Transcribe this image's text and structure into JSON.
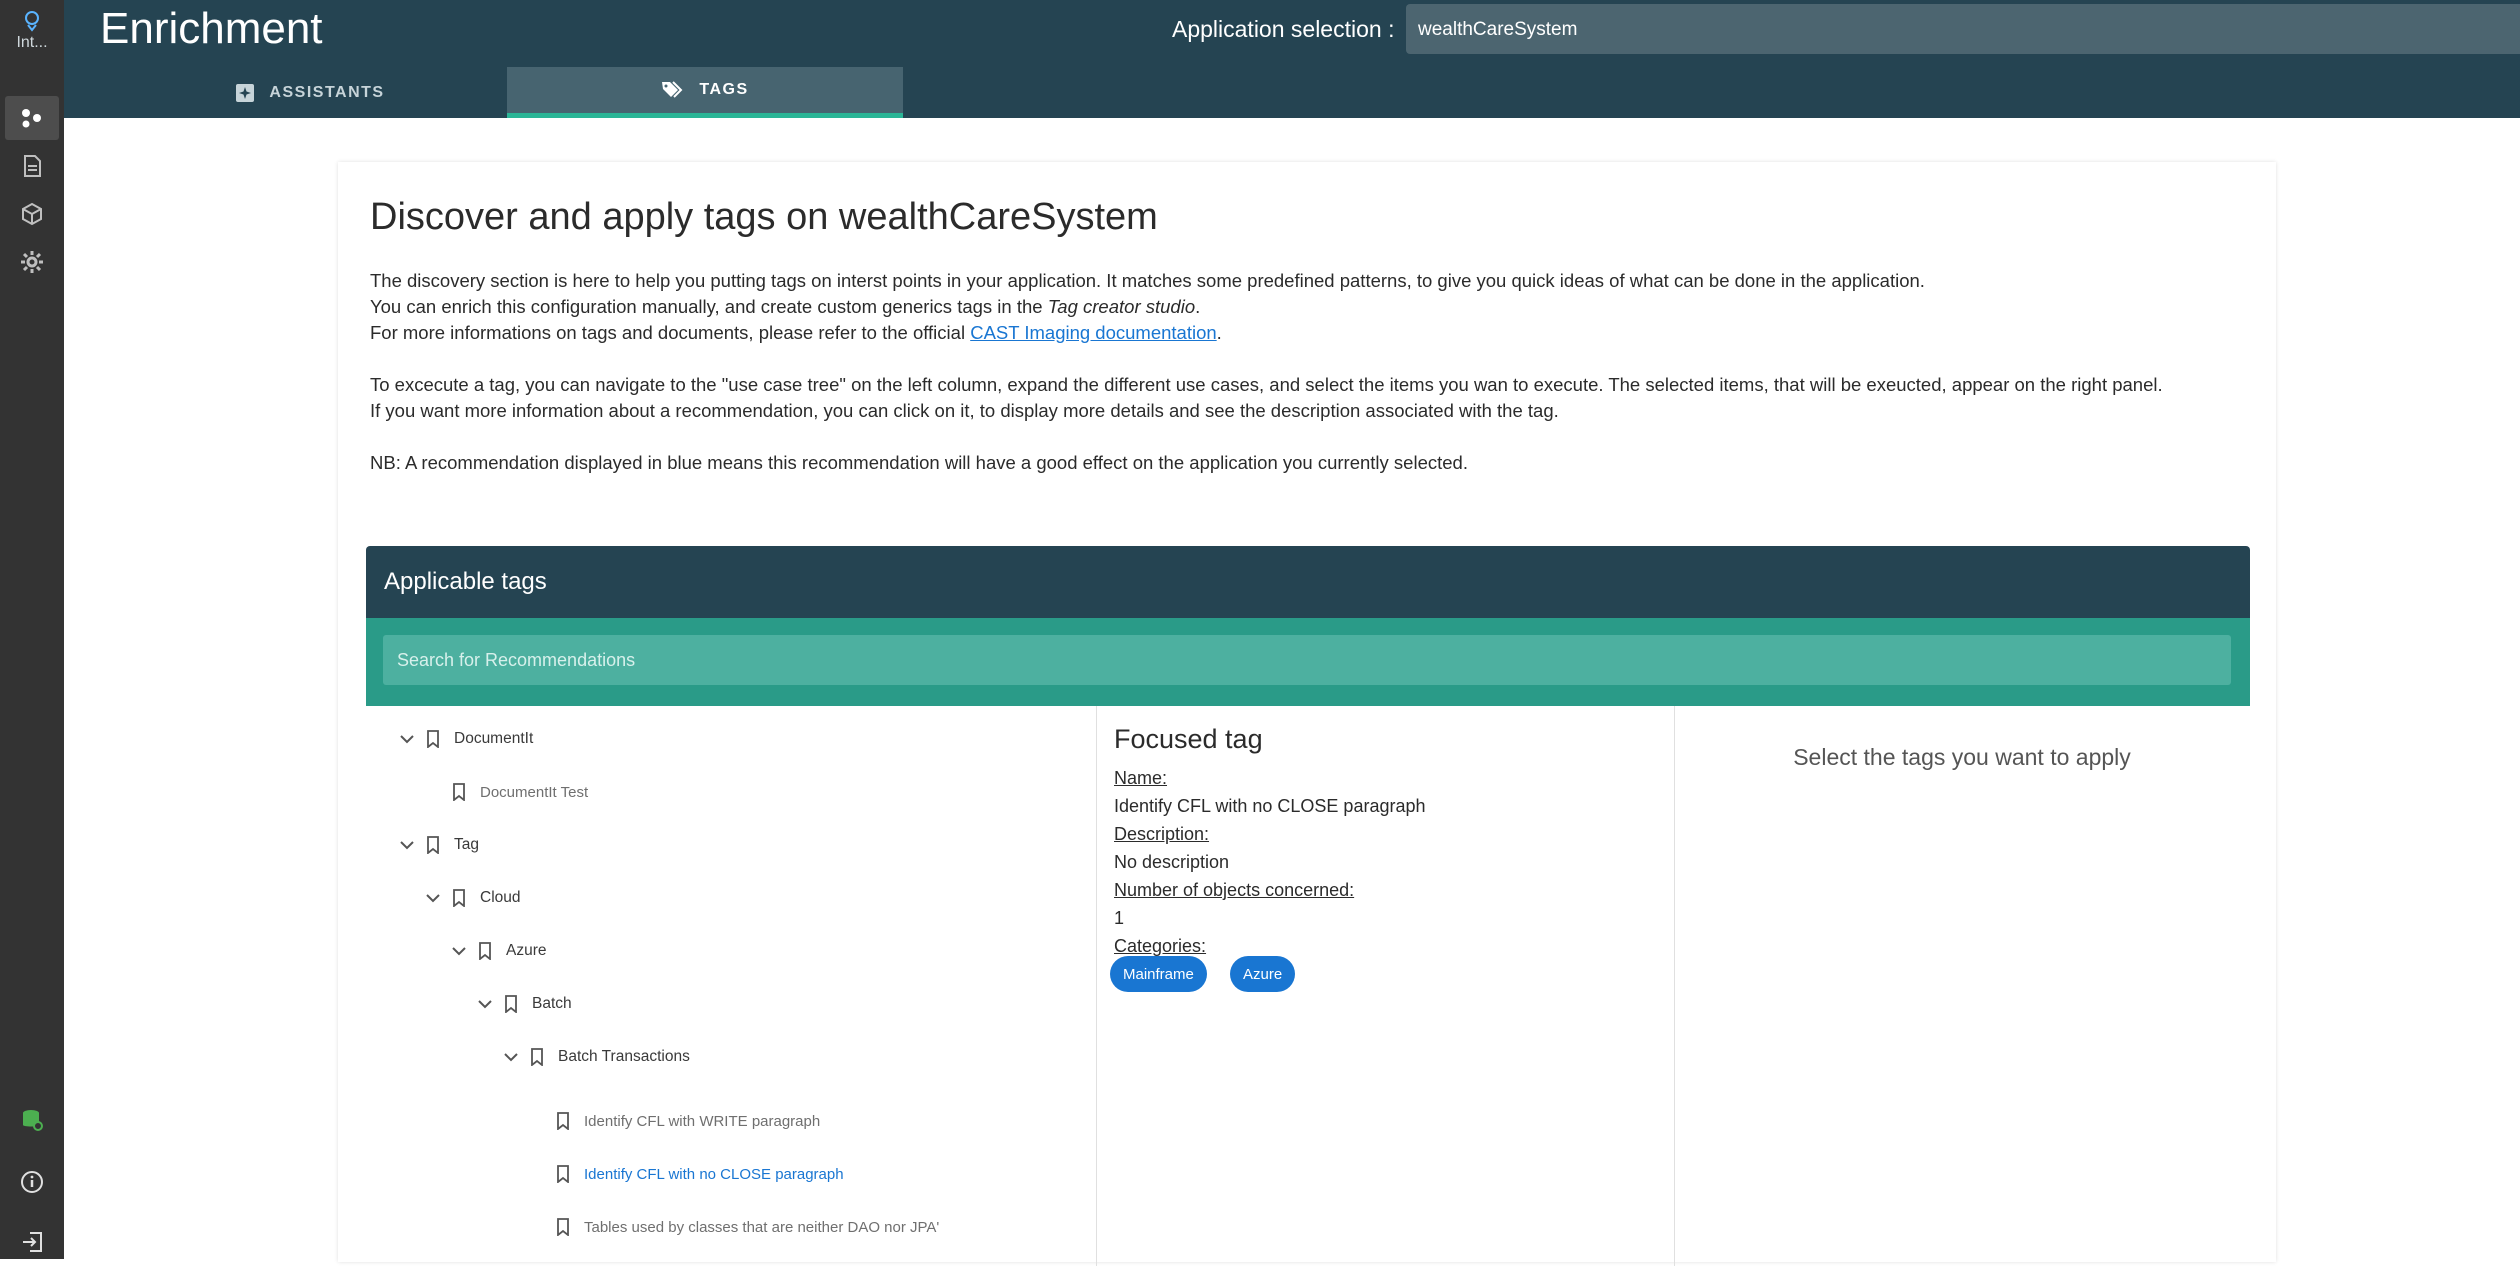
{
  "rail": {
    "app_label": "Int..."
  },
  "header": {
    "title": "Enrichment",
    "app_selection_label": "Application selection :",
    "app_selection_value": "wealthCareSystem",
    "tabs": [
      {
        "label": "ASSISTANTS",
        "icon": "assistant-icon",
        "active": false
      },
      {
        "label": "TAGS",
        "icon": "tags-icon",
        "active": true
      }
    ]
  },
  "main": {
    "heading": "Discover and apply tags on wealthCareSystem",
    "para1_line1": "The discovery section is here to help you putting tags on interst points in your application. It matches some predefined patterns, to give you quick ideas of what can be done in the application.",
    "para1_line2_pre": "You can enrich this configuration manually, and create custom generics tags in the ",
    "para1_line2_em": "Tag creator studio",
    "para1_line2_post": ".",
    "para1_line3_pre": "For more informations on tags and documents, please refer to the official ",
    "para1_line3_link": "CAST Imaging documentation",
    "para1_line3_post": ".",
    "para2_line1": "To excecute a tag, you can navigate to the \"use case tree\" on the left column, expand the different use cases, and select the items you wan to execute. The selected items, that will be exeucted, appear on the right panel.",
    "para2_line2": "If you want more information about a recommendation, you can click on it, to display more details and see the description associated with the tag.",
    "para3": "NB: A recommendation displayed in blue means this recommendation will have a good effect on the application you currently selected."
  },
  "panel": {
    "title": "Applicable tags",
    "search_placeholder": "Search for Recommendations",
    "tree": [
      {
        "label": "DocumentIt",
        "level": 0,
        "expandable": true
      },
      {
        "label": "DocumentIt Test",
        "level": 1,
        "expandable": false
      },
      {
        "label": "Tag",
        "level": 0,
        "expandable": true
      },
      {
        "label": "Cloud",
        "level": 1,
        "expandable": true
      },
      {
        "label": "Azure",
        "level": 2,
        "expandable": true
      },
      {
        "label": "Batch",
        "level": 3,
        "expandable": true
      },
      {
        "label": "Batch Transactions",
        "level": 4,
        "expandable": true
      },
      {
        "label": "Identify CFL with WRITE paragraph",
        "level": 5,
        "expandable": false
      },
      {
        "label": "Identify CFL with no CLOSE paragraph",
        "level": 5,
        "expandable": false,
        "focused": true
      },
      {
        "label": "Tables used by classes that are neither DAO nor JPA'",
        "level": 5,
        "expandable": false
      }
    ],
    "focused": {
      "title": "Focused tag",
      "name_label": "Name:",
      "name_value": "Identify CFL with no CLOSE paragraph",
      "description_label": "Description:",
      "description_value": "No description",
      "objects_label": "Number of objects concerned:",
      "objects_value": "1",
      "categories_label": "Categories:",
      "categories": [
        "Mainframe",
        "Azure"
      ]
    },
    "apply_hint": "Select the tags you want to apply"
  },
  "colors": {
    "header_bg": "#254452",
    "rail_bg": "#333333",
    "accent": "#2bb596",
    "search_band": "#2a9b88",
    "chip": "#1976d2",
    "link": "#1976d2"
  }
}
